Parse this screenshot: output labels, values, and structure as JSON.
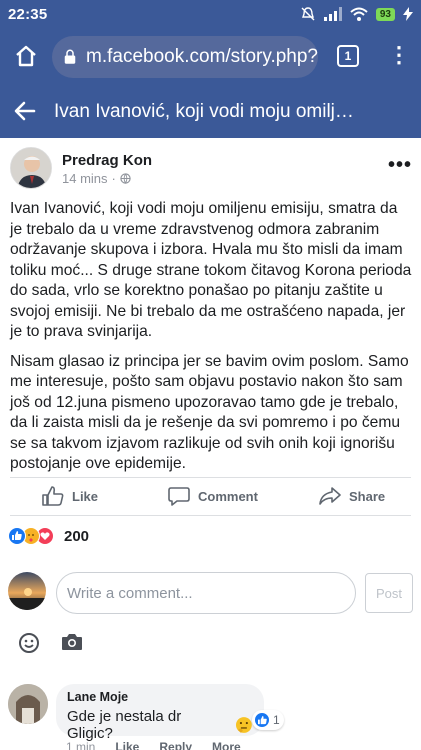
{
  "status_bar": {
    "time": "22:35",
    "battery": "93"
  },
  "browser": {
    "url": "m.facebook.com/story.php?",
    "tab_count": "1"
  },
  "header": {
    "title": "Ivan Ivanović, koji vodi moju omiljenu e..."
  },
  "post": {
    "author": "Predrag Kon",
    "time": "14 mins",
    "paragraphs": [
      "Ivan Ivanović, koji vodi moju omiljenu emisiju, smatra da je trebalo da u vreme zdravstvenog odmora zabranim održavanje skupova i izbora. Hvala mu što misli da imam toliku moć... S druge strane tokom čitavog Korona perioda do sada, vrlo se korektno ponašao po pitanju zaštite u svojoj emisiji. Ne bi trebalo da me ostrašćeno napada, jer je to prava svinjarija.",
      "Nisam glasao iz principa jer se bavim ovim poslom. Samo me interesuje, pošto sam objavu postavio nakon što sam još od 12.juna pismeno upozoravao tamo gde je trebalo, da li zaista misli da je rešenje da svi pomremo i po čemu se sa takvom izjavom razlikuje od svih onih koji ignorišu postojanje ove epidemije."
    ],
    "actions": {
      "like": "Like",
      "comment": "Comment",
      "share": "Share"
    },
    "reaction_count": "200"
  },
  "composer": {
    "placeholder": "Write a comment...",
    "post_label": "Post"
  },
  "comment": {
    "author": "Lane Moje",
    "text": "Gde je nestala dr Gligic?",
    "reaction_count": "1",
    "time": "1 min",
    "like": "Like",
    "reply": "Reply",
    "more": "More"
  },
  "colors": {
    "facebook_blue": "#3b5998",
    "like_blue": "#1877f2",
    "love_red": "#f33e58"
  }
}
